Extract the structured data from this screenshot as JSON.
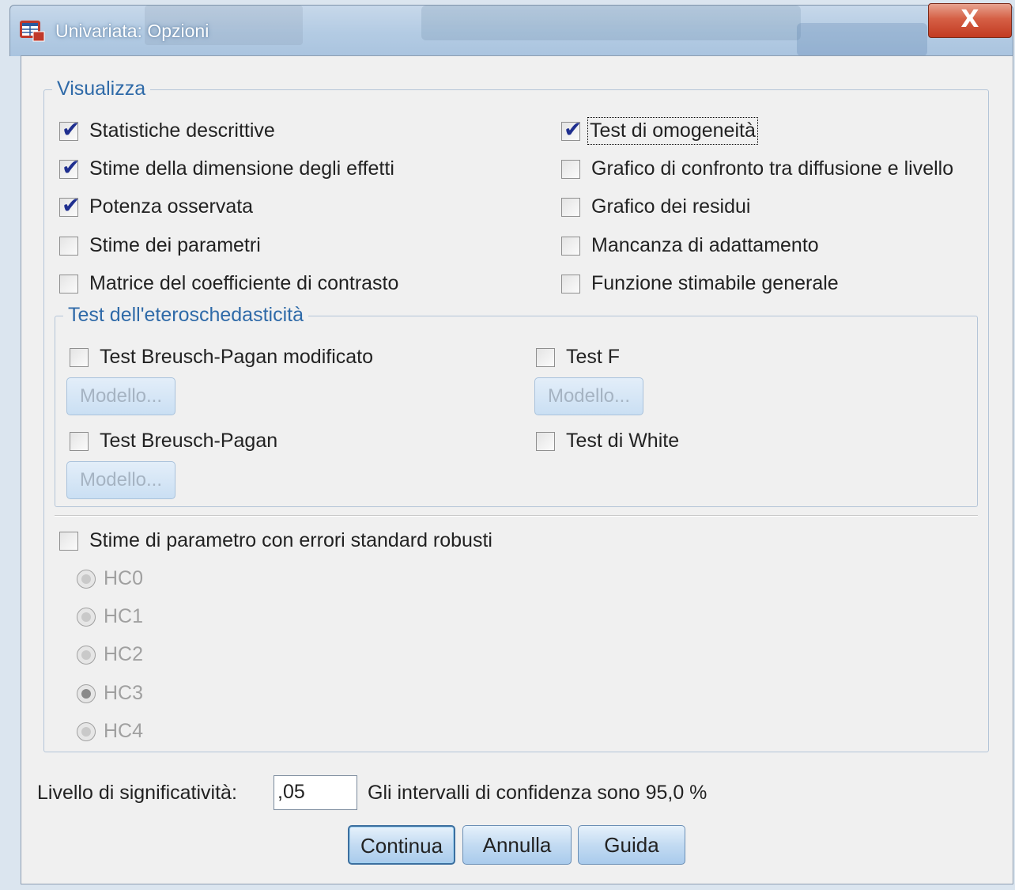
{
  "window": {
    "title": "Univariata: Opzioni",
    "close_label": "X",
    "icon": "spss-table-icon"
  },
  "visualizza": {
    "legend": "Visualizza",
    "left": [
      {
        "label": "Statistiche descrittive",
        "checked": true
      },
      {
        "label": "Stime della dimensione degli effetti",
        "checked": true
      },
      {
        "label": "Potenza osservata",
        "checked": true
      },
      {
        "label": "Stime dei parametri",
        "checked": false
      },
      {
        "label": "Matrice del coefficiente di contrasto",
        "checked": false
      }
    ],
    "right": [
      {
        "label": "Test di omogeneità",
        "checked": true
      },
      {
        "label": "Grafico di confronto tra diffusione e livello",
        "checked": false
      },
      {
        "label": "Grafico dei residui",
        "checked": false
      },
      {
        "label": "Mancanza di adattamento",
        "checked": false
      },
      {
        "label": "Funzione stimabile generale",
        "checked": false
      }
    ]
  },
  "hetero": {
    "legend": "Test dell'eteroschedasticità",
    "bp_mod_label": "Test Breusch-Pagan modificato",
    "f_label": "Test F",
    "bp_label": "Test Breusch-Pagan",
    "white_label": "Test di White",
    "model_button": "Modello..."
  },
  "robust": {
    "label": "Stime di parametro con errori standard robusti",
    "options": [
      "HC0",
      "HC1",
      "HC2",
      "HC3",
      "HC4"
    ],
    "selected": "HC3"
  },
  "footer": {
    "significance_label": "Livello di significatività:",
    "significance_value": ",05",
    "confidence_text": "Gli intervalli di confidenza sono 95,0 %",
    "continue_label": "Continua",
    "cancel_label": "Annulla",
    "help_label": "Guida"
  },
  "colors": {
    "group_label": "#2f6aa8",
    "check": "#1f2f8f",
    "close": "#c23b22"
  }
}
